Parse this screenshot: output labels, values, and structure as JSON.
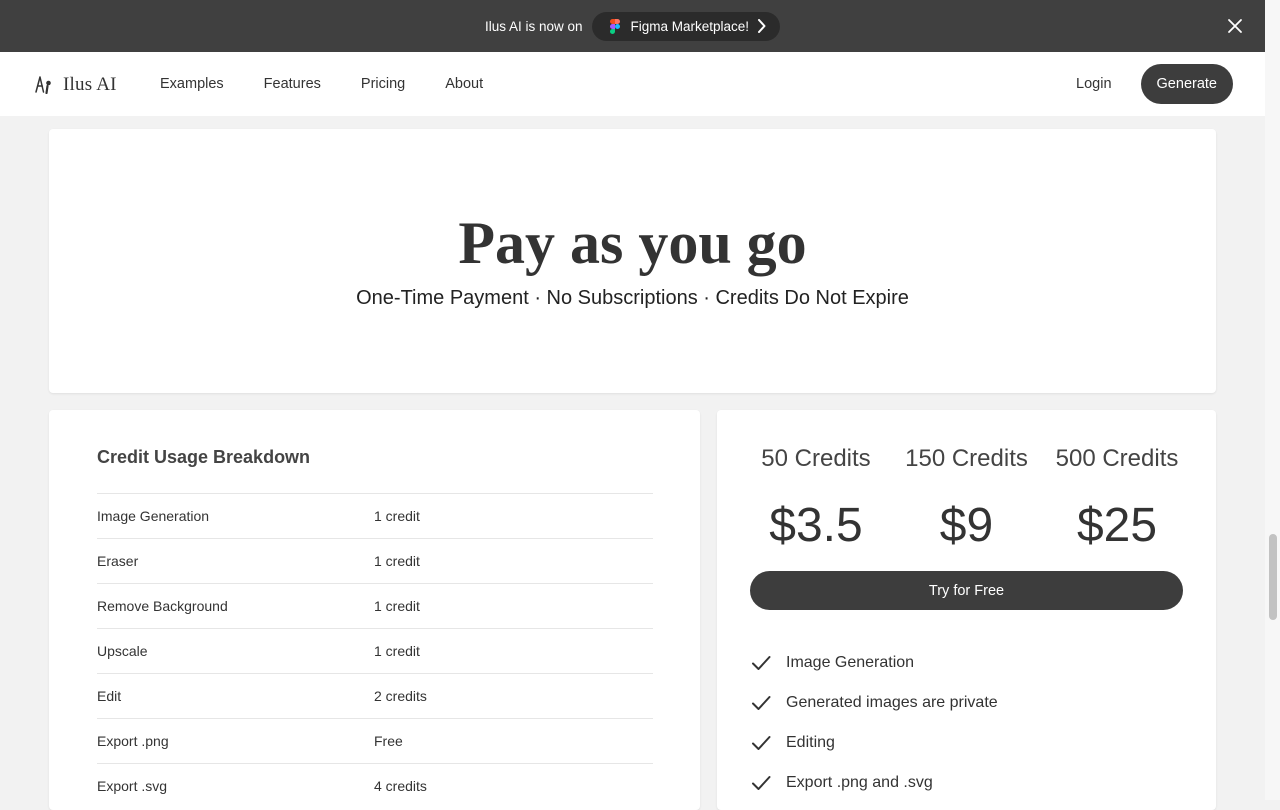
{
  "banner": {
    "text": "Ilus AI is now on",
    "pill_label": "Figma Marketplace!"
  },
  "nav": {
    "brand": "Ilus AI",
    "links": [
      "Examples",
      "Features",
      "Pricing",
      "About"
    ],
    "login": "Login",
    "generate": "Generate"
  },
  "hero": {
    "title": "Pay as you go",
    "subtitle": "One-Time Payment · No Subscriptions · Credits Do Not Expire"
  },
  "usage": {
    "title": "Credit Usage Breakdown",
    "rows": [
      {
        "name": "Image Generation",
        "cost": "1 credit"
      },
      {
        "name": "Eraser",
        "cost": "1 credit"
      },
      {
        "name": "Remove Background",
        "cost": "1 credit"
      },
      {
        "name": "Upscale",
        "cost": "1 credit"
      },
      {
        "name": "Edit",
        "cost": "2 credits"
      },
      {
        "name": "Export .png",
        "cost": "Free"
      },
      {
        "name": "Export .svg",
        "cost": "4 credits"
      }
    ]
  },
  "pricing": {
    "tiers": [
      {
        "credits": "50 Credits",
        "price": "$3.5"
      },
      {
        "credits": "150 Credits",
        "price": "$9"
      },
      {
        "credits": "500 Credits",
        "price": "$25"
      }
    ],
    "cta": "Try for Free",
    "features": [
      "Image Generation",
      "Generated images are private",
      "Editing",
      "Export .png and .svg"
    ]
  },
  "icons": {
    "banner": [
      "figma-icon",
      "chevron-right-icon",
      "close-icon"
    ],
    "brand": "logo-icon",
    "feature": "check-icon"
  },
  "colors": {
    "banner_bg": "#404040",
    "button_bg": "#3d3d3d",
    "page_bg": "#f2f2f2"
  },
  "scroll": {
    "position": 0.68
  }
}
